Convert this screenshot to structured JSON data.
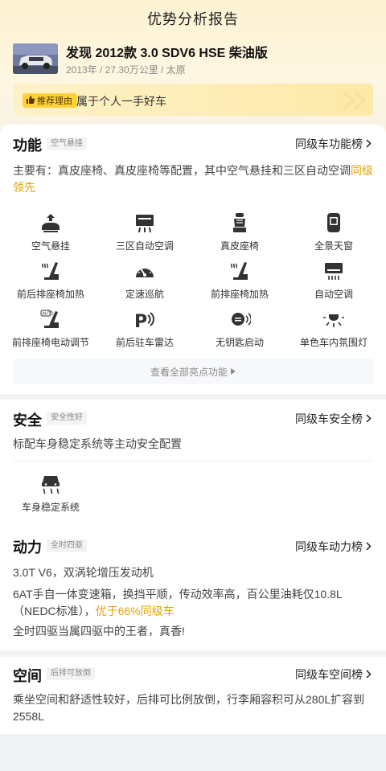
{
  "header": {
    "title": "优势分析报告"
  },
  "car": {
    "name": "发现 2012款 3.0 SDV6 HSE 柴油版",
    "meta": "2013年 / 27.30万公里 / 太原"
  },
  "recommend": {
    "tag": "推荐理由",
    "text": "属于个人一手好车"
  },
  "function": {
    "title": "功能",
    "badge": "空气悬挂",
    "link": "同级车功能榜",
    "desc_main": "主要有：真皮座椅、真皮座椅等配置，其中空气悬挂和三区自动空调",
    "desc_highlight": "同级领先",
    "items": [
      {
        "label": "空气悬挂",
        "icon": "air-suspension-icon"
      },
      {
        "label": "三区自动空调",
        "icon": "tri-zone-ac-icon"
      },
      {
        "label": "真皮座椅",
        "icon": "leather-seat-icon"
      },
      {
        "label": "全景天窗",
        "icon": "panoramic-sunroof-icon"
      },
      {
        "label": "前后排座椅加热",
        "icon": "seat-heating-icon"
      },
      {
        "label": "定速巡航",
        "icon": "cruise-control-icon"
      },
      {
        "label": "前排座椅加热",
        "icon": "front-seat-heating-icon"
      },
      {
        "label": "自动空调",
        "icon": "auto-ac-icon"
      },
      {
        "label": "前排座椅电动调节",
        "icon": "power-seat-icon"
      },
      {
        "label": "前后驻车雷达",
        "icon": "parking-radar-icon"
      },
      {
        "label": "无钥匙启动",
        "icon": "keyless-start-icon"
      },
      {
        "label": "单色车内氛围灯",
        "icon": "ambient-light-icon"
      }
    ],
    "more_label": "查看全部亮点功能"
  },
  "safety": {
    "title": "安全",
    "badge": "安全性好",
    "link": "同级车安全榜",
    "desc": "标配车身稳定系统等主动安全配置",
    "items": [
      {
        "label": "车身稳定系统",
        "icon": "stability-control-icon"
      }
    ]
  },
  "power": {
    "title": "动力",
    "badge": "全时四驱",
    "link": "同级车动力榜",
    "line1": "3.0T V6，双涡轮增压发动机",
    "line2_main": "6AT手自一体变速箱，换挡平顺，传动效率高，百公里油耗仅10.8L（NEDC标准），",
    "line2_highlight": "优于66%同级车",
    "line3": "全时四驱当属四驱中的王者，真香!"
  },
  "space": {
    "title": "空间",
    "badge": "后排可放倒",
    "link": "同级车空间榜",
    "desc": "乘坐空间和舒适性较好，后排可比例放倒，行李厢容积可从280L扩容到2558L"
  },
  "colors": {
    "accent": "#e5a000",
    "tag": "#ffd23a"
  }
}
